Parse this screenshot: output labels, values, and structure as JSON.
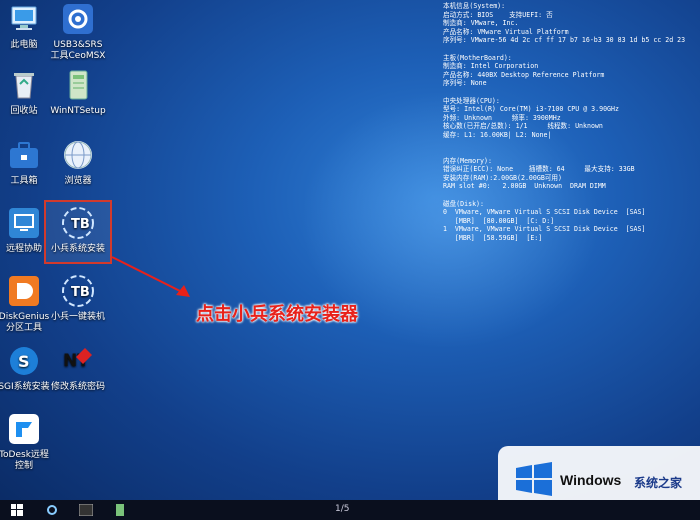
{
  "desktop": {
    "icons": [
      {
        "label": "此电脑"
      },
      {
        "label": "USB3&SRS\n工具CeoMSX"
      },
      {
        "label": "回收站"
      },
      {
        "label": "WinNTSetup"
      },
      {
        "label": "工具箱"
      },
      {
        "label": "浏览器"
      },
      {
        "label": "远程协助"
      },
      {
        "label": "小兵系统安装"
      },
      {
        "label": "DiskGenius\n分区工具"
      },
      {
        "label": "小兵一键装机"
      },
      {
        "label": "SGI系统安装"
      },
      {
        "label": "修改系统密码"
      },
      {
        "label": "ToDesk远程\n控制"
      }
    ]
  },
  "info": {
    "lines": [
      "本机信息(System):",
      "启动方式: BIOS    支持UEFI: 否",
      "制造商: VMware, Inc.",
      "产品名称: VMware Virtual Platform",
      "序列号: VMware-56 4d 2c cf ff 17 b7 16-b3 30 83 1d b5 cc 2d 23",
      "",
      "主板(MotherBoard):",
      "制造商: Intel Corporation",
      "产品名称: 440BX Desktop Reference Platform",
      "序列号: None",
      "",
      "中央处理器(CPU):",
      "型号: Intel(R) Core(TM) i3-7100 CPU @ 3.90GHz",
      "外频: Unknown     频率: 3900MHz",
      "核心数(已开启/总数): 1/1     线程数: Unknown",
      "缓存: L1: 16.00KB| L2: None|",
      "",
      "",
      "内存(Memory):",
      "错误纠正(ECC): None    插槽数: 64     最大支持: 33GB",
      "安装内存(RAM):2.00GB(2.00GB可用)",
      "RAM slot #0:   2.00GB  Unknown  DRAM DIMM",
      "",
      "磁盘(Disk):",
      "0  VMware, VMware Virtual S SCSI Disk Device  [SAS]",
      "   [MBR]  [80.00GB]  [C: D:]",
      "1  VMware, VMware Virtual S SCSI Disk Device  [SAS]",
      "   [MBR]  [58.59GB]  [E:]"
    ]
  },
  "annotation": {
    "text": "点击小兵系统安装器"
  },
  "taskbar": {
    "page": "1/5"
  },
  "watermark": {
    "brand": "Windows",
    "site": "系统之家"
  },
  "colors": {
    "annotation": "#e8211a",
    "highlight_box": "#d23a2c"
  }
}
